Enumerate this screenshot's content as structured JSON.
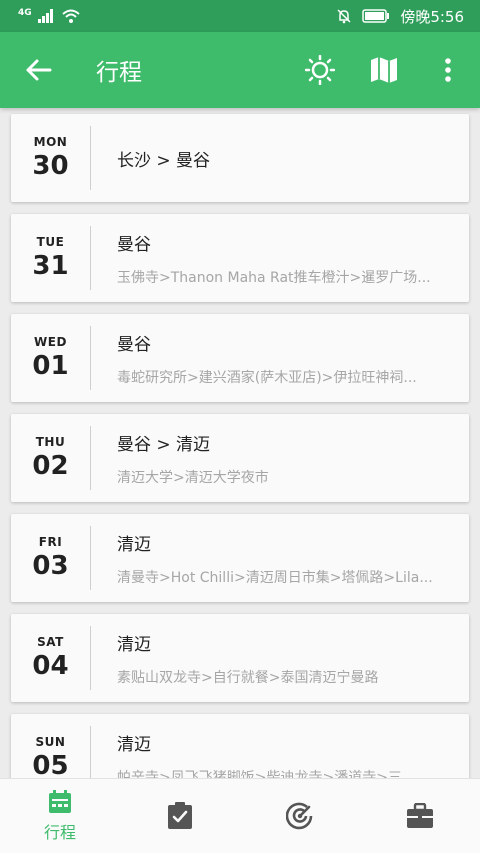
{
  "status_bar": {
    "network": "4G",
    "time": "傍晚5:56",
    "icons": [
      "signal-icon",
      "wifi-icon",
      "mute-bell-icon",
      "battery-icon"
    ]
  },
  "app_bar": {
    "title": "行程",
    "icons": [
      "back-arrow-icon",
      "sun-icon",
      "map-icon",
      "more-vert-icon"
    ]
  },
  "days": [
    {
      "dow": "MON",
      "day": "30",
      "place": "长沙 > 曼谷",
      "route": ""
    },
    {
      "dow": "TUE",
      "day": "31",
      "place": "曼谷",
      "route": "玉佛寺>Thanon Maha Rat推车橙汁>暹罗广场..."
    },
    {
      "dow": "WED",
      "day": "01",
      "place": "曼谷",
      "route": "毒蛇研究所>建兴酒家(萨木亚店)>伊拉旺神祠..."
    },
    {
      "dow": "THU",
      "day": "02",
      "place": "曼谷 > 清迈",
      "route": "清迈大学>清迈大学夜市"
    },
    {
      "dow": "FRI",
      "day": "03",
      "place": "清迈",
      "route": "清曼寺>Hot Chilli>清迈周日市集>塔佩路>Lila..."
    },
    {
      "dow": "SAT",
      "day": "04",
      "place": "清迈",
      "route": "素贴山双龙寺>自行就餐>泰国清迈宁曼路"
    },
    {
      "dow": "SUN",
      "day": "05",
      "place": "清迈",
      "route": "帕辛寺>凤飞飞猪脚饭>柴迪龙寺>潘道寺>三..."
    }
  ],
  "bottom_nav": {
    "active_label": "行程",
    "accent": "#3fbc6b",
    "inactive": "#555555",
    "icons": [
      "calendar-icon",
      "checklist-icon",
      "radar-icon",
      "briefcase-icon"
    ]
  }
}
